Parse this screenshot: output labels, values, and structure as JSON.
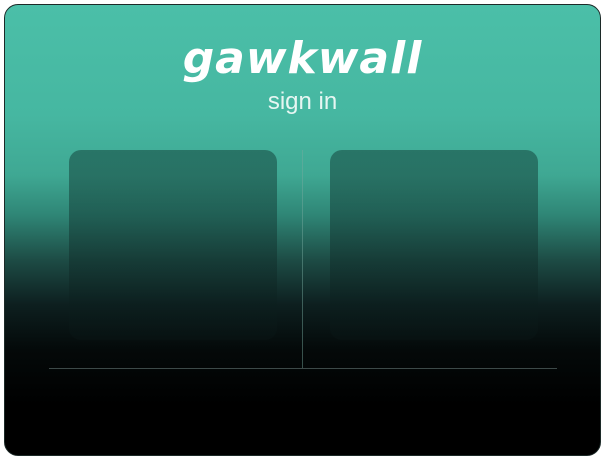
{
  "app": {
    "logo_text": "gawkwall",
    "subtitle": "sign in"
  },
  "colors": {
    "accent": "#4bbfa8",
    "background_bottom": "#000000",
    "text": "#ffffff"
  }
}
